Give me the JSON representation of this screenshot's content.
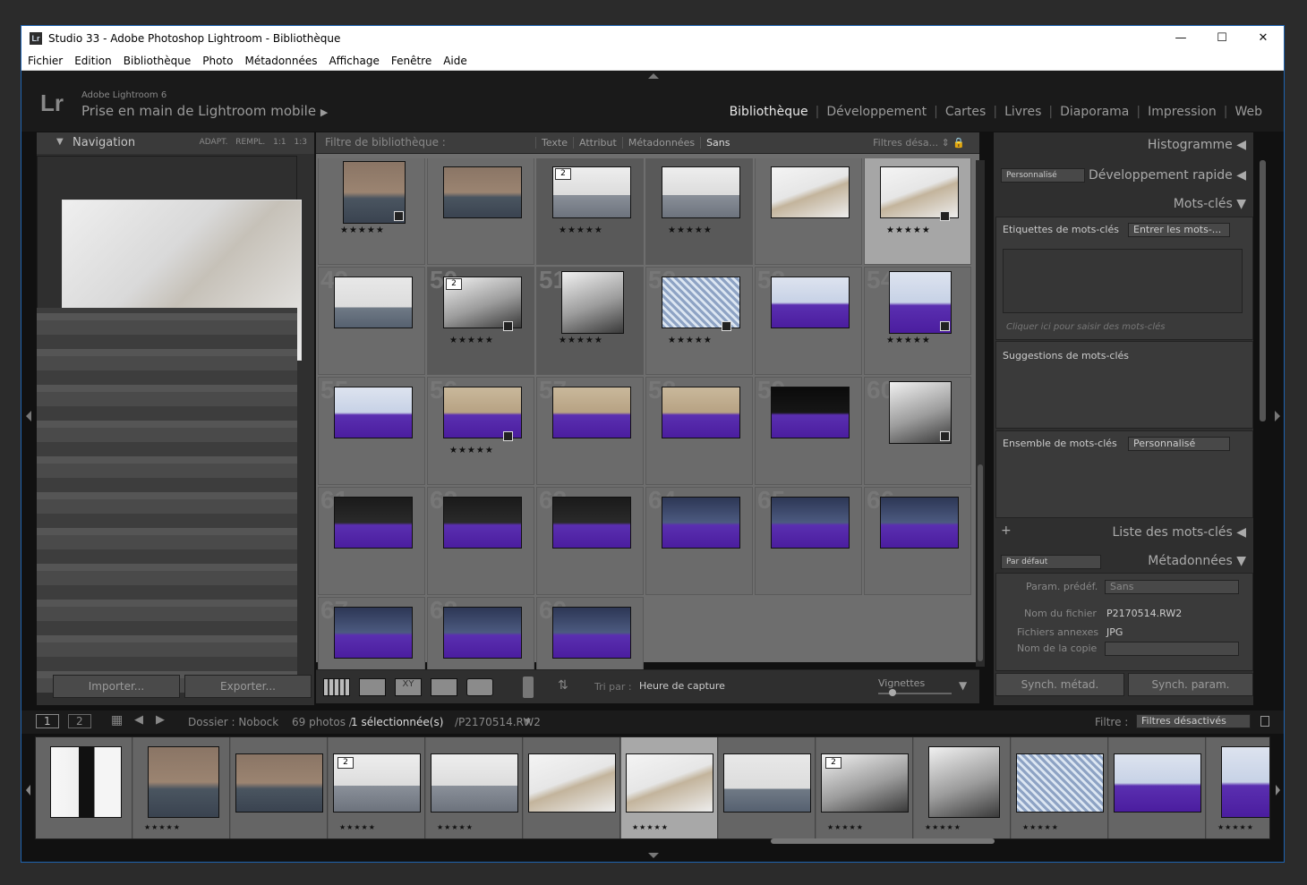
{
  "window": {
    "title": "Studio 33 - Adobe Photoshop Lightroom - Bibliothèque",
    "min": "—",
    "max": "☐",
    "close": "✕",
    "logo": "Lr"
  },
  "menu": [
    "Fichier",
    "Edition",
    "Bibliothèque",
    "Photo",
    "Métadonnées",
    "Affichage",
    "Fenêtre",
    "Aide"
  ],
  "identity": {
    "logo": "Lr",
    "version": "Adobe Lightroom 6",
    "catalog": "Prise en main de Lightroom mobile",
    "arrow": "▶"
  },
  "modules": [
    "Bibliothèque",
    "Développement",
    "Cartes",
    "Livres",
    "Diaporama",
    "Impression",
    "Web"
  ],
  "navigator": {
    "title": "Navigation",
    "opts": "ADAPT. REMPL. 1:1 1:3"
  },
  "left_buttons": {
    "import": "Importer...",
    "export": "Exporter..."
  },
  "filter": {
    "label": "Filtre de bibliothèque :",
    "tabs": [
      "Texte",
      "Attribut",
      "Métadonnées",
      "Sans"
    ],
    "active": "Sans",
    "right": "Filtres désa..."
  },
  "grid": {
    "numbers": [
      "",
      "",
      "",
      "",
      "",
      "",
      "49",
      "50",
      "51",
      "52",
      "53",
      "54",
      "55",
      "56",
      "57",
      "58",
      "59",
      "60",
      "61",
      "62",
      "63",
      "64",
      "65",
      "66",
      "67",
      "68",
      "69"
    ],
    "stars": "★★★★★",
    "stack_badges": [
      "2",
      "2"
    ]
  },
  "toolbar": {
    "sort_label": "Tri par :",
    "sort_value": "Heure de capture",
    "thumbs_label": "Vignettes"
  },
  "right": {
    "histogram": "Histogramme",
    "quick_develop": "Développement rapide",
    "quick_preset": "Personnalisé",
    "keywords": "Mots-clés",
    "kw_tags": "Etiquettes de mots-clés",
    "kw_tags_value": "Entrer les mots-...",
    "kw_placeholder": "Cliquer ici pour saisir des mots-clés",
    "kw_suggestions": "Suggestions de mots-clés",
    "kw_set": "Ensemble de mots-clés",
    "kw_set_value": "Personnalisé",
    "kw_list": "Liste des mots-clés",
    "metadata": "Métadonnées",
    "meta_preset_dd": "Par défaut",
    "meta_param": "Param. prédéf.",
    "meta_param_value": "Sans",
    "filename_label": "Nom du fichier",
    "filename_value": "P2170514.RW2",
    "sidecar_label": "Fichiers annexes",
    "sidecar_value": "JPG",
    "copyname_label": "Nom de la copie",
    "sync_meta": "Synch. métad.",
    "sync_settings": "Synch. param."
  },
  "status": {
    "view1": "1",
    "view2": "2",
    "folder": "Dossier : Nobock",
    "count": "69 photos /",
    "selected": "1 sélectionnée(s)",
    "file": "/P2170514.RW2",
    "filter_label": "Filtre :",
    "filter_value": "Filtres désactivés"
  },
  "filmstrip": {
    "stars": "★★★★★",
    "badge": "2"
  }
}
